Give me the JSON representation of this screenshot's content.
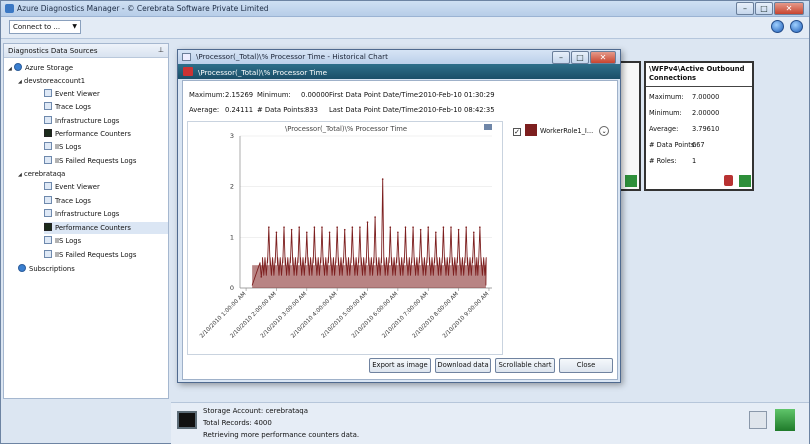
{
  "window": {
    "title": "Azure Diagnostics Manager - © Cerebrata Software Private Limited"
  },
  "toolbar": {
    "connect_label": "Connect to ..."
  },
  "sidebar": {
    "header": "Diagnostics Data Sources",
    "items": [
      {
        "label": "Azure Storage"
      },
      {
        "label": "devstoreaccount1"
      },
      {
        "label": "Event Viewer"
      },
      {
        "label": "Trace Logs"
      },
      {
        "label": "Infrastructure Logs"
      },
      {
        "label": "Performance Counters"
      },
      {
        "label": "IIS Logs"
      },
      {
        "label": "IIS Failed Requests Logs"
      },
      {
        "label": "cerebrataqa"
      },
      {
        "label": "Event Viewer"
      },
      {
        "label": "Trace Logs"
      },
      {
        "label": "Infrastructure Logs"
      },
      {
        "label": "Performance Counters"
      },
      {
        "label": "IIS Logs"
      },
      {
        "label": "IIS Failed Requests Logs"
      },
      {
        "label": "Subscriptions"
      }
    ]
  },
  "panel_b": {
    "title": "\\WFPv4\\Active Outbound Connections",
    "rows": [
      {
        "label": "Maximum:",
        "value": "7.00000"
      },
      {
        "label": "Minimum:",
        "value": "2.00000"
      },
      {
        "label": "Average:",
        "value": "3.79610"
      },
      {
        "label": "# Data Points:",
        "value": "667"
      },
      {
        "label": "# Roles:",
        "value": "1"
      }
    ]
  },
  "dialog": {
    "title": "\\Processor(_Total)\\% Processor Time - Historical Chart",
    "banner": "\\Processor(_Total)\\% Processor Time",
    "stats": {
      "maximum_label": "Maximum:",
      "maximum": "2.15269",
      "minimum_label": "Minimum:",
      "minimum": "0.00000",
      "average_label": "Average:",
      "average": "0.24111",
      "points_label": "# Data Points:",
      "points": "833",
      "first_label": "First Data Point Date/Time:",
      "first": "2010-Feb-10 01:30:29",
      "last_label": "Last Data Point Date/Time:",
      "last": "2010-Feb-10 08:42:35"
    },
    "legend_label": "WorkerRole1_I...",
    "buttons": {
      "export": "Export as image",
      "download": "Download data",
      "scrollable": "Scrollable chart",
      "close": "Close"
    }
  },
  "status": {
    "account": "Storage Account: cerebrataqa",
    "records": "Total Records: 4000",
    "message": "Retrieving more performance counters data."
  },
  "colors": {
    "series": "#7d1f1f",
    "banner": "#1b4f68"
  },
  "chart_data": {
    "type": "line",
    "title": "\\Processor(_Total)\\% Processor Time",
    "xlabel": "",
    "ylabel": "",
    "ylim": [
      0,
      3
    ],
    "yticks": [
      "0",
      "1",
      "2",
      "3"
    ],
    "xticks": [
      "2/10/2010 1:00:00 AM",
      "2/10/2010 2:00:00 AM",
      "2/10/2010 3:00:00 AM",
      "2/10/2010 4:00:00 AM",
      "2/10/2010 5:00:00 AM",
      "2/10/2010 6:00:00 AM",
      "2/10/2010 7:00:00 AM",
      "2/10/2010 8:00:00 AM",
      "2/10/2010 9:00:00 AM"
    ],
    "xrange_hours": [
      0.8,
      9.1
    ],
    "series": [
      {
        "name": "WorkerRole1_I...",
        "color": "#7d1f1f",
        "x_hours": [
          1.5,
          1.75,
          2.0,
          2.25,
          2.5,
          2.75,
          3.0,
          3.25,
          3.5,
          3.75,
          4.0,
          4.25,
          4.5,
          4.75,
          5.0,
          5.25,
          5.5,
          5.75,
          6.0,
          6.25,
          6.5,
          6.75,
          7.0,
          7.25,
          7.5,
          7.75,
          8.0,
          8.25,
          8.5,
          8.7
        ],
        "peaks": [
          0.22,
          1.2,
          1.1,
          1.2,
          1.15,
          1.2,
          1.1,
          1.2,
          1.2,
          1.1,
          1.2,
          1.15,
          1.2,
          1.2,
          1.3,
          1.4,
          2.15,
          1.2,
          1.1,
          1.2,
          1.2,
          1.15,
          1.2,
          1.1,
          1.2,
          1.2,
          1.15,
          1.2,
          1.1,
          1.2
        ],
        "baseline": 0.05
      }
    ]
  }
}
